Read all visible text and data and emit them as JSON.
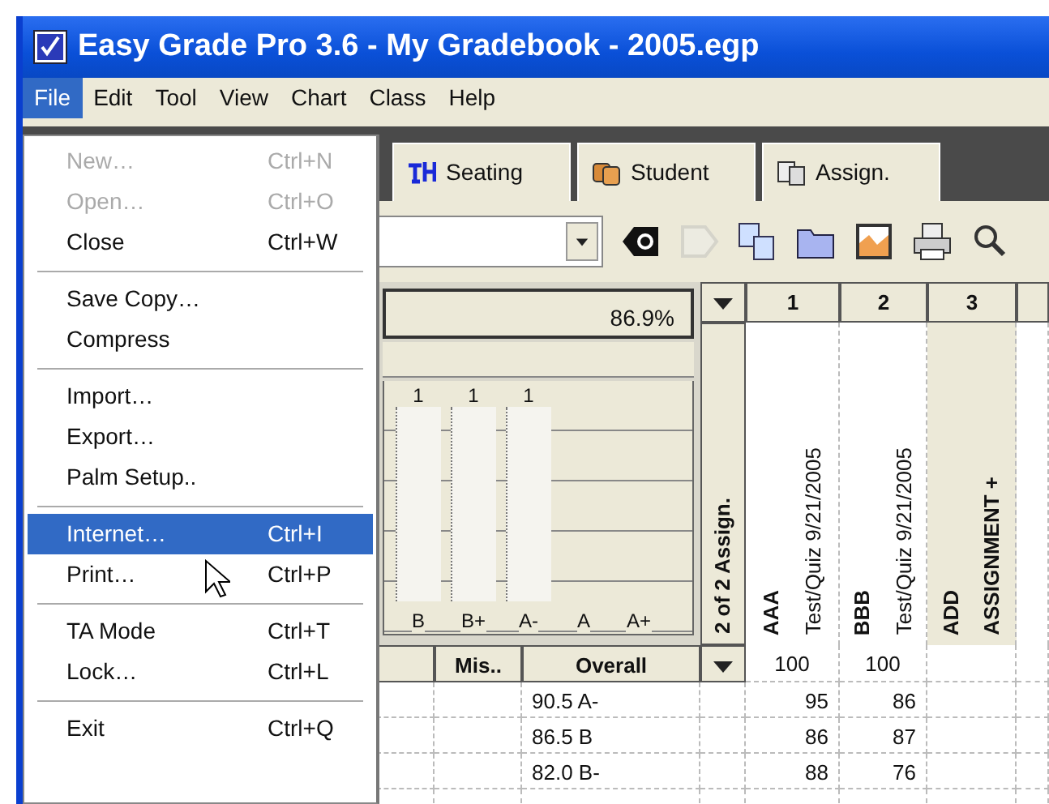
{
  "window": {
    "title": "Easy Grade Pro 3.6 - My Gradebook - 2005.egp"
  },
  "menu_bar": [
    {
      "label": "File",
      "selected": true
    },
    {
      "label": "Edit",
      "selected": false
    },
    {
      "label": "Tool",
      "selected": false
    },
    {
      "label": "View",
      "selected": false
    },
    {
      "label": "Chart",
      "selected": false
    },
    {
      "label": "Class",
      "selected": false
    },
    {
      "label": "Help",
      "selected": false
    }
  ],
  "file_menu": [
    {
      "kind": "item",
      "label": "New…",
      "shortcut": "Ctrl+N",
      "disabled": true,
      "selected": false
    },
    {
      "kind": "item",
      "label": "Open…",
      "shortcut": "Ctrl+O",
      "disabled": true,
      "selected": false
    },
    {
      "kind": "item",
      "label": "Close",
      "shortcut": "Ctrl+W",
      "disabled": false,
      "selected": false
    },
    {
      "kind": "separator"
    },
    {
      "kind": "item",
      "label": "Save Copy…",
      "disabled": false,
      "selected": false
    },
    {
      "kind": "item",
      "label": "Compress",
      "disabled": false,
      "selected": false
    },
    {
      "kind": "separator"
    },
    {
      "kind": "item",
      "label": "Import…",
      "disabled": false,
      "selected": false
    },
    {
      "kind": "item",
      "label": "Export…",
      "disabled": false,
      "selected": false
    },
    {
      "kind": "item",
      "label": "Palm Setup..",
      "disabled": false,
      "selected": false
    },
    {
      "kind": "separator"
    },
    {
      "kind": "item",
      "label": "Internet…",
      "shortcut": "Ctrl+I",
      "disabled": false,
      "selected": true
    },
    {
      "kind": "item",
      "label": "Print…",
      "shortcut": "Ctrl+P",
      "disabled": false,
      "selected": false
    },
    {
      "kind": "separator"
    },
    {
      "kind": "item",
      "label": "TA Mode",
      "shortcut": "Ctrl+T",
      "disabled": false,
      "selected": false
    },
    {
      "kind": "item",
      "label": "Lock…",
      "shortcut": "Ctrl+L",
      "disabled": false,
      "selected": false
    },
    {
      "kind": "separator"
    },
    {
      "kind": "item",
      "label": "Exit",
      "shortcut": "Ctrl+Q",
      "disabled": false,
      "selected": false
    }
  ],
  "tabs": [
    {
      "label": "Seating",
      "selected": false
    },
    {
      "label": "Student",
      "selected": false
    },
    {
      "label": "Assign.",
      "selected": false
    }
  ],
  "toolbar": [
    {
      "kind": "back",
      "disabled": false
    },
    {
      "kind": "next",
      "disabled": true
    },
    {
      "kind": "swap",
      "disabled": false
    },
    {
      "kind": "folder",
      "disabled": false
    },
    {
      "kind": "chart",
      "disabled": false
    },
    {
      "kind": "print",
      "disabled": false
    },
    {
      "kind": "search",
      "disabled": false
    }
  ],
  "summary": {
    "percent": "86.9%"
  },
  "grade_chart": {
    "bins": [
      {
        "label": "B",
        "count": "1"
      },
      {
        "label": "B+",
        "count": "1"
      },
      {
        "label": "A-",
        "count": "1"
      },
      {
        "label": "A"
      },
      {
        "label": "A+"
      }
    ]
  },
  "assign_count": "2 of 2 Assign.",
  "assignments": [
    {
      "kind": "assignment",
      "number": "1",
      "name": "AAA",
      "detail": "Test/Quiz 9/21/2005",
      "points": "100"
    },
    {
      "kind": "assignment",
      "number": "2",
      "name": "BBB",
      "detail": "Test/Quiz 9/21/2005",
      "points": "100"
    },
    {
      "kind": "add",
      "number": "3",
      "name": "ADD",
      "detail": "ASSIGNMENT +"
    }
  ],
  "student_columns": [
    "Mis..",
    "Overall"
  ],
  "rows": [
    {
      "overall": "90.5 A-",
      "scores": [
        "95",
        "86"
      ]
    },
    {
      "overall": "86.5 B",
      "scores": [
        "86",
        "87"
      ]
    },
    {
      "overall": "82.0 B-",
      "scores": [
        "88",
        "76"
      ]
    }
  ]
}
